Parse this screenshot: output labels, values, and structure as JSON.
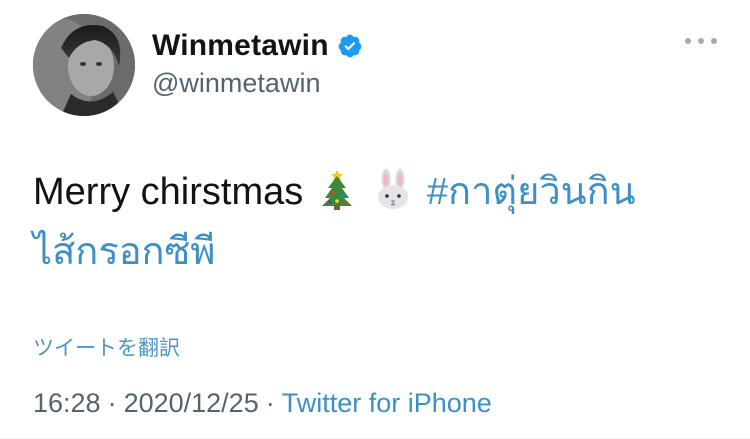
{
  "tweet": {
    "display_name": "Winmetawin",
    "handle": "@winmetawin",
    "text_plain": "Merry chirstmas",
    "hashtag_line1": "#กาตุ่ยวินกิน",
    "hashtag_line2": "ไส้กรอกซีพี",
    "translate_label": "ツイートを翻訳",
    "time": "16:28",
    "date": "2020/12/25",
    "separator": "·",
    "source": "Twitter for iPhone",
    "emoji": [
      "christmas-tree",
      "rabbit-face"
    ]
  },
  "colors": {
    "text": "#0f1419",
    "secondary": "#536471",
    "link": "#3b90c8",
    "verified": "#1d9bf0"
  }
}
